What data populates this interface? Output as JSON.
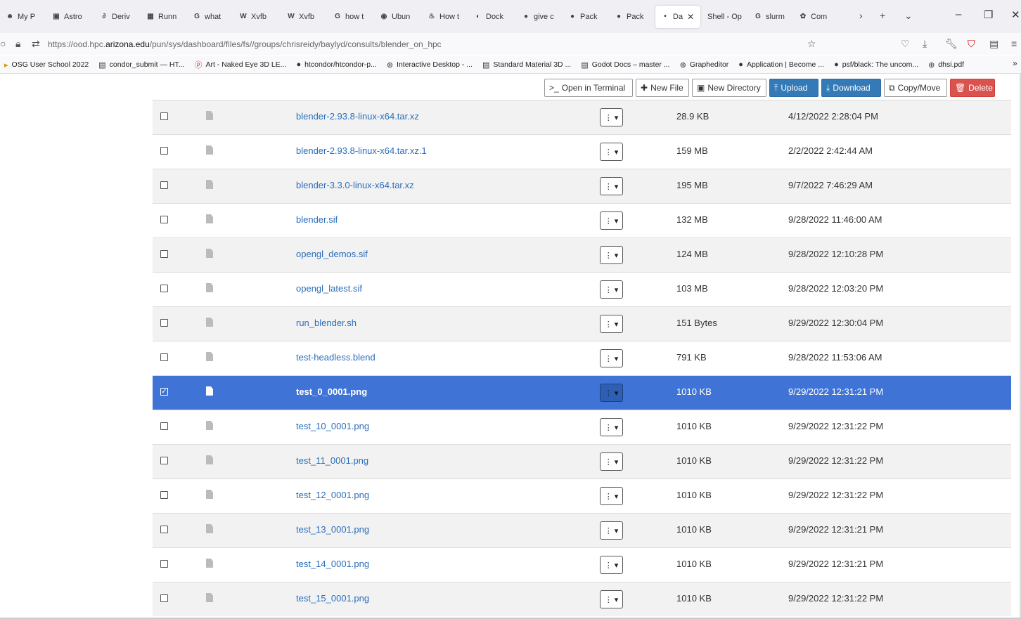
{
  "browser": {
    "tabs": [
      {
        "label": "My P",
        "icon": "person-icon"
      },
      {
        "label": "Astro",
        "icon": "astro-icon"
      },
      {
        "label": "Deriv",
        "icon": "deriv-icon"
      },
      {
        "label": "Runn",
        "icon": "runn-icon"
      },
      {
        "label": "what",
        "icon": "google-icon"
      },
      {
        "label": "Xvfb",
        "icon": "wikipedia-icon"
      },
      {
        "label": "Xvfb",
        "icon": "wikipedia-icon"
      },
      {
        "label": "how t",
        "icon": "google-icon"
      },
      {
        "label": "Ubun",
        "icon": "ubuntu-icon"
      },
      {
        "label": "How t",
        "icon": "howto-icon"
      },
      {
        "label": "Dock",
        "icon": "docker-icon"
      },
      {
        "label": "give c",
        "icon": "github-icon"
      },
      {
        "label": "Pack",
        "icon": "github-icon"
      },
      {
        "label": "Pack",
        "icon": "github-icon"
      },
      {
        "label": "Da",
        "icon": "dot-icon",
        "active": true
      },
      {
        "label": "Shell - Op",
        "icon": "none"
      },
      {
        "label": "slurm",
        "icon": "google-icon"
      },
      {
        "label": "Com",
        "icon": "com-icon"
      }
    ],
    "url_prefix": "https://ood.hpc.",
    "url_domain": "arizona.edu",
    "url_path": "/pun/sys/dashboard/files/fs//groups/chrisreidy/baylyd/consults/blender_on_hpc",
    "bookmarks": [
      {
        "label": "OSG User School 2022",
        "icon": "folder-icon"
      },
      {
        "label": "condor_submit — HT...",
        "icon": "page-icon"
      },
      {
        "label": "Art - Naked Eye 3D LE...",
        "icon": "pinterest-icon"
      },
      {
        "label": "htcondor/htcondor-p...",
        "icon": "github-icon"
      },
      {
        "label": "Interactive Desktop - ...",
        "icon": "globe-icon"
      },
      {
        "label": "Standard Material 3D ...",
        "icon": "page-icon"
      },
      {
        "label": "Godot Docs – master ...",
        "icon": "page-icon"
      },
      {
        "label": "Grapheditor",
        "icon": "globe-icon"
      },
      {
        "label": "Application | Become ...",
        "icon": "github-icon"
      },
      {
        "label": "psf/black: The uncom...",
        "icon": "github-icon"
      },
      {
        "label": "dhsi.pdf",
        "icon": "globe-icon"
      }
    ]
  },
  "toolbar": {
    "open_terminal": "Open in Terminal",
    "new_file": "New File",
    "new_directory": "New Directory",
    "upload": "Upload",
    "download": "Download",
    "copy_move": "Copy/Move",
    "delete": "Delete"
  },
  "files": [
    {
      "name": "blender-2.93.8-linux-x64.tar.xz",
      "size": "28.9 KB",
      "modified": "4/12/2022 2:28:04 PM"
    },
    {
      "name": "blender-2.93.8-linux-x64.tar.xz.1",
      "size": "159 MB",
      "modified": "2/2/2022 2:42:44 AM"
    },
    {
      "name": "blender-3.3.0-linux-x64.tar.xz",
      "size": "195 MB",
      "modified": "9/7/2022 7:46:29 AM"
    },
    {
      "name": "blender.sif",
      "size": "132 MB",
      "modified": "9/28/2022 11:46:00 AM"
    },
    {
      "name": "opengl_demos.sif",
      "size": "124 MB",
      "modified": "9/28/2022 12:10:28 PM"
    },
    {
      "name": "opengl_latest.sif",
      "size": "103 MB",
      "modified": "9/28/2022 12:03:20 PM"
    },
    {
      "name": "run_blender.sh",
      "size": "151 Bytes",
      "modified": "9/29/2022 12:30:04 PM"
    },
    {
      "name": "test-headless.blend",
      "size": "791 KB",
      "modified": "9/28/2022 11:53:06 AM"
    },
    {
      "name": "test_0_0001.png",
      "size": "1010 KB",
      "modified": "9/29/2022 12:31:21 PM",
      "selected": true
    },
    {
      "name": "test_10_0001.png",
      "size": "1010 KB",
      "modified": "9/29/2022 12:31:22 PM"
    },
    {
      "name": "test_11_0001.png",
      "size": "1010 KB",
      "modified": "9/29/2022 12:31:22 PM"
    },
    {
      "name": "test_12_0001.png",
      "size": "1010 KB",
      "modified": "9/29/2022 12:31:22 PM"
    },
    {
      "name": "test_13_0001.png",
      "size": "1010 KB",
      "modified": "9/29/2022 12:31:21 PM"
    },
    {
      "name": "test_14_0001.png",
      "size": "1010 KB",
      "modified": "9/29/2022 12:31:21 PM"
    },
    {
      "name": "test_15_0001.png",
      "size": "1010 KB",
      "modified": "9/29/2022 12:31:22 PM"
    }
  ],
  "colors": {
    "selected_row": "#3f74d6",
    "link": "#2a6ebb",
    "primary_button": "#337ab7",
    "danger_button": "#d9534f"
  }
}
